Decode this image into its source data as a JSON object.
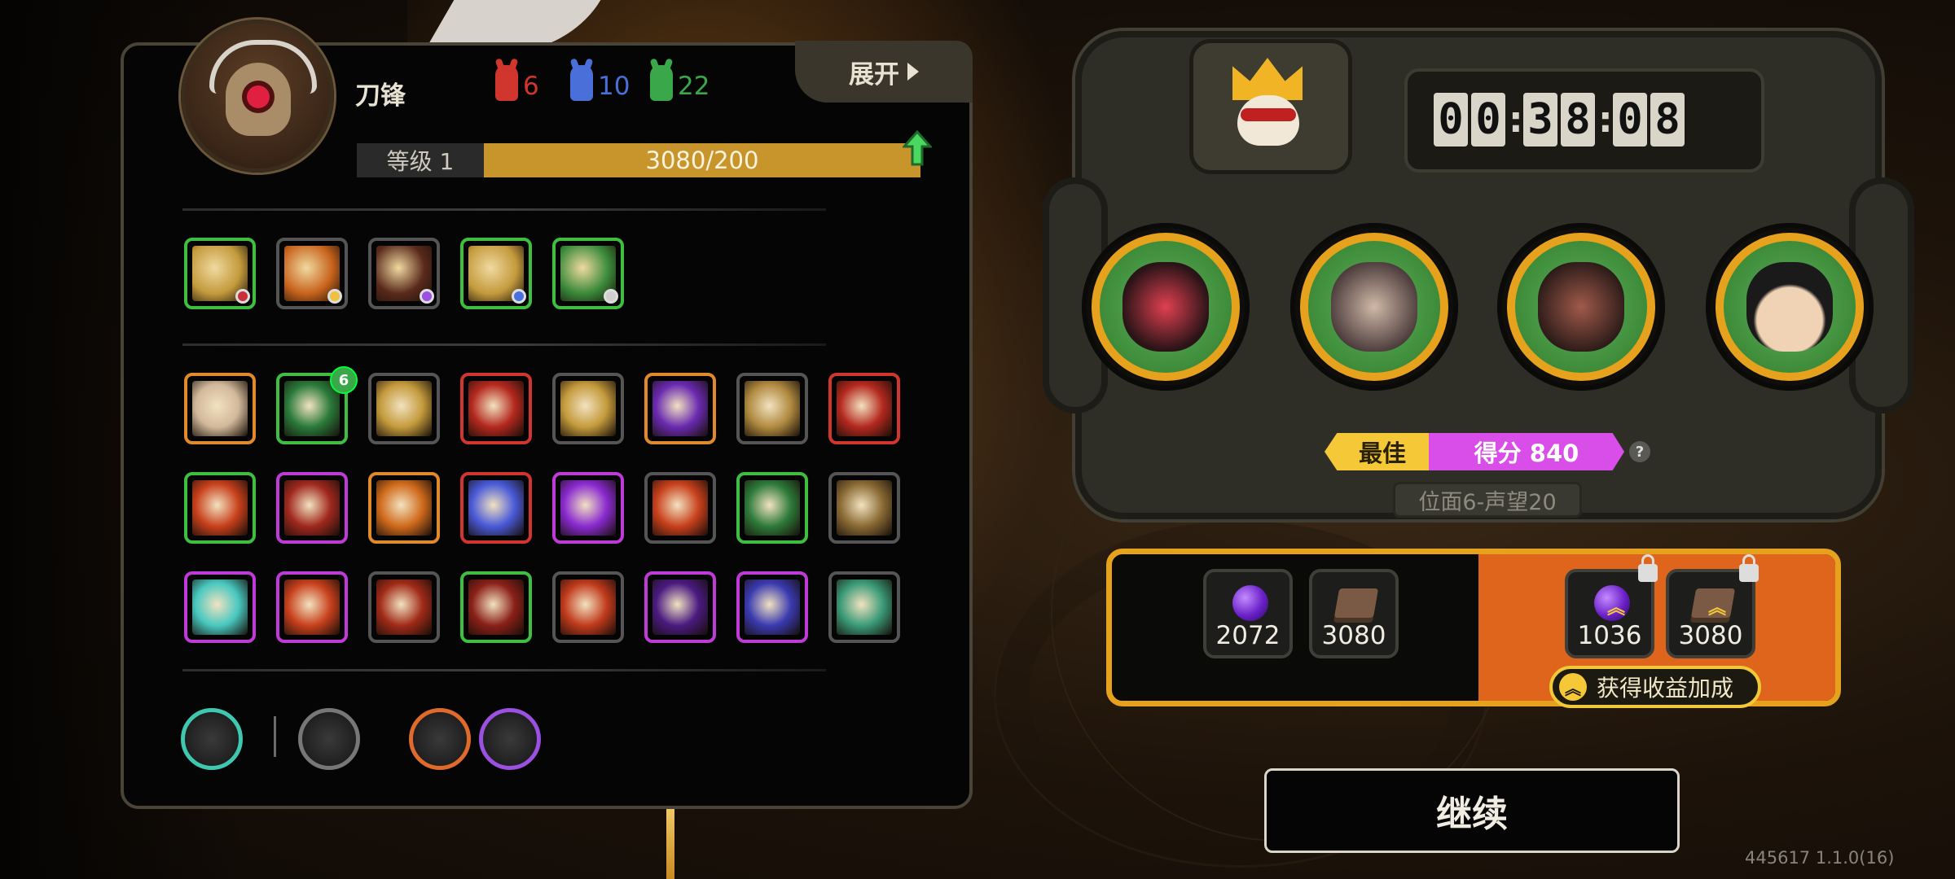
{
  "hero": {
    "name": "刀锋",
    "level_label": "等级 1",
    "xp_text": "3080/200",
    "expand_label": "展开"
  },
  "resources": [
    {
      "icon": "red-horn-icon",
      "value": "6",
      "color": "#d0352e"
    },
    {
      "icon": "blue-horn-icon",
      "value": "10",
      "color": "#4a6fd8"
    },
    {
      "icon": "green-horn-icon",
      "value": "22",
      "color": "#3aa84a"
    }
  ],
  "equipped_skills": [
    {
      "icon": "claw-skill-icon",
      "border": "#3fbf3f",
      "art": "#c49a3c",
      "gem": "#c8303a"
    },
    {
      "icon": "flame-aura-skill-icon",
      "border": "#555555",
      "art": "#c8631c",
      "gem": "#f0c040"
    },
    {
      "icon": "target-skill-icon",
      "border": "#555555",
      "art": "#5a2a1c",
      "gem": "#9a50e0"
    },
    {
      "icon": "blade-totem-skill-icon",
      "border": "#3fbf3f",
      "art": "#c49a3c",
      "gem": "#4a70e0"
    },
    {
      "icon": "green-scarab-skill-icon",
      "border": "#3fbf3f",
      "art": "#3a8a3a",
      "gem": "#cfcfcf"
    }
  ],
  "passive_skills": [
    {
      "icon": "gear-emblem-icon",
      "border": "#e08a2c",
      "art": "#d2b89a"
    },
    {
      "icon": "green-shield-icon",
      "border": "#3fbf3f",
      "art": "#2a7a3a",
      "badge": "6"
    },
    {
      "icon": "lightning-strike-icon",
      "border": "#555555",
      "art": "#c49a3c"
    },
    {
      "icon": "slash-icon",
      "border": "#d0352e",
      "art": "#b4281e"
    },
    {
      "icon": "chain-link-icon",
      "border": "#555555",
      "art": "#c49a3c"
    },
    {
      "icon": "purple-smoke-icon",
      "border": "#e08a2c",
      "art": "#6a2ab0"
    },
    {
      "icon": "sunrise-icon",
      "border": "#555555",
      "art": "#b08a40"
    },
    {
      "icon": "double-slash-icon",
      "border": "#d0352e",
      "art": "#b4281e"
    },
    {
      "icon": "fire-claw-icon",
      "border": "#3fbf3f",
      "art": "#c8401c"
    },
    {
      "icon": "golden-arrows-icon",
      "border": "#c03ad8",
      "art": "#a0281e"
    },
    {
      "icon": "fire-spirit-icon",
      "border": "#e08a2c",
      "art": "#d06a1c"
    },
    {
      "icon": "masked-ninja-icon",
      "border": "#d0352e",
      "art": "#4a5ad8"
    },
    {
      "icon": "purple-goo-icon",
      "border": "#c03ad8",
      "art": "#8a2ad0"
    },
    {
      "icon": "flame-hand-icon",
      "border": "#555555",
      "art": "#c8401c"
    },
    {
      "icon": "green-blade-icon",
      "border": "#3fbf3f",
      "art": "#2e7a3a"
    },
    {
      "icon": "gold-seal-icon",
      "border": "#555555",
      "art": "#8a6a34"
    },
    {
      "icon": "star-burst-icon",
      "border": "#c03ad8",
      "art": "#48c8c0"
    },
    {
      "icon": "fire-orb-icon",
      "border": "#c03ad8",
      "art": "#c8401c"
    },
    {
      "icon": "fire-wall-icon",
      "border": "#555555",
      "art": "#a02a18"
    },
    {
      "icon": "arrow-volley-icon",
      "border": "#3fbf3f",
      "art": "#8a2018"
    },
    {
      "icon": "pointing-hand-icon",
      "border": "#555555",
      "art": "#c03a1c"
    },
    {
      "icon": "purple-fist-icon",
      "border": "#c03ad8",
      "art": "#4a1a80"
    },
    {
      "icon": "thorn-ring-icon",
      "border": "#c03ad8",
      "art": "#3a3ab0"
    },
    {
      "icon": "green-spear-icon",
      "border": "#555555",
      "art": "#3a9a78"
    }
  ],
  "bottom_icons": [
    {
      "icon": "telescope-icon",
      "color": "#3fc8b0"
    },
    {
      "icon": "scorpion-icon",
      "color": "#777777"
    },
    {
      "icon": "orange-check-icon",
      "color": "#e06a2c"
    },
    {
      "icon": "purple-heart-icon",
      "color": "#9a50e0"
    }
  ],
  "timer": {
    "h1": "0",
    "h2": "0",
    "m1": "3",
    "m2": "8",
    "s1": "0",
    "s2": "8"
  },
  "team": [
    {
      "icon": "red-insect-face-icon"
    },
    {
      "icon": "armored-mask-icon"
    },
    {
      "icon": "hooded-crow-icon"
    },
    {
      "icon": "curly-hair-glasses-icon"
    }
  ],
  "score": {
    "best_label": "最佳",
    "score_text": "得分 840",
    "help": "?"
  },
  "realm_text": "位面6-声望20",
  "rewards": {
    "base": [
      {
        "icon": "purple-orb-icon",
        "value": "2072"
      },
      {
        "icon": "book-icon",
        "value": "3080"
      }
    ],
    "bonus": [
      {
        "icon": "purple-orb-icon",
        "value": "1036"
      },
      {
        "icon": "book-icon",
        "value": "3080"
      }
    ],
    "bonus_button": "获得收益加成"
  },
  "continue_label": "继续",
  "version": "445617 1.1.0(16)"
}
